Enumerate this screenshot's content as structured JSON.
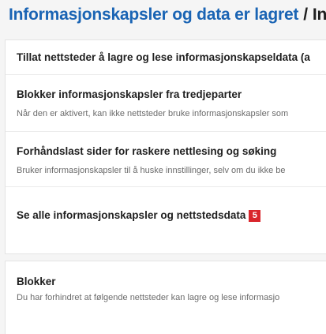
{
  "breadcrumb": {
    "parent": "Informasjonskapsler og data er lagret",
    "separator": "/",
    "current": "Inf"
  },
  "settings": {
    "allow_sites": {
      "title": "Tillat nettsteder å lagre og lese informasjonskapseldata (a"
    },
    "block_third_party": {
      "title": "Blokker informasjonskapsler fra tredjeparter",
      "description": "Når den er aktivert, kan ikke nettsteder bruke informasjonskapsler som"
    },
    "preload": {
      "title": "Forhåndslast sider for raskere nettlesing og søking",
      "description": "Bruker informasjonskapsler til å huske innstillinger, selv om du ikke be"
    },
    "see_all": {
      "title": "Se alle informasjonskapsler og nettstedsdata",
      "badge": "5"
    }
  },
  "block_section": {
    "title": "Blokker",
    "description": "Du har forhindret at følgende nettsteder kan lagre og lese informasjo"
  },
  "colors": {
    "link": "#1a64b4",
    "badge": "#d9262c",
    "background": "#f5f5f5"
  }
}
